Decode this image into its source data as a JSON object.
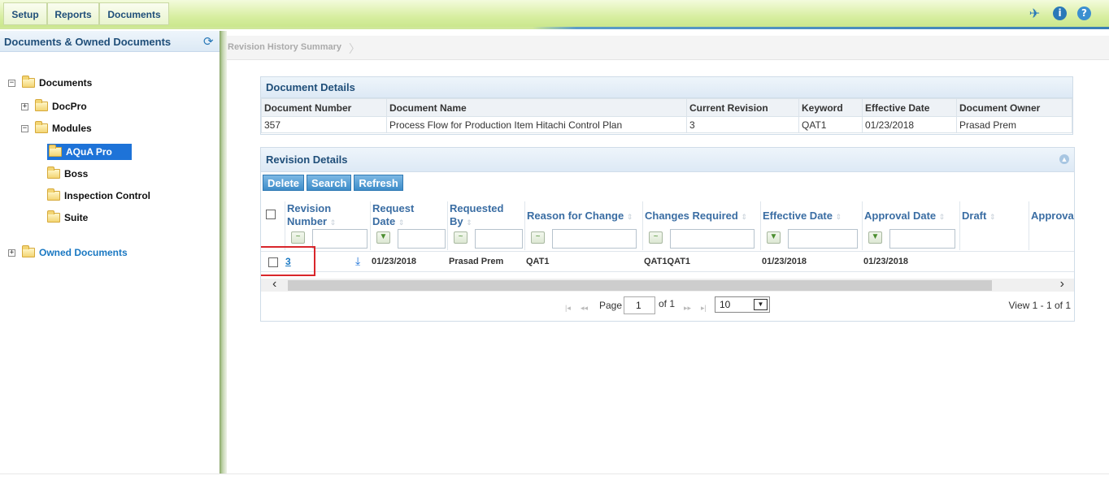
{
  "tabs": [
    {
      "label": "Setup"
    },
    {
      "label": "Reports"
    },
    {
      "label": "Documents"
    }
  ],
  "top_icons": {
    "pin": "pin-icon",
    "info": "i",
    "help": "?"
  },
  "left": {
    "title": "Documents & Owned Documents",
    "tree": {
      "documents": "Documents",
      "docpro": "DocPro",
      "modules": "Modules",
      "aqua_pro": "AQuA Pro",
      "boss": "Boss",
      "inspection_control": "Inspection Control",
      "suite": "Suite",
      "owned_documents": "Owned Documents"
    }
  },
  "breadcrumb": "Revision History Summary",
  "document_details": {
    "title": "Document Details",
    "headers": [
      "Document Number",
      "Document Name",
      "Current Revision",
      "Keyword",
      "Effective Date",
      "Document Owner"
    ],
    "row": [
      "357",
      "Process Flow for Production Item Hitachi Control Plan",
      "3",
      "QAT1",
      "01/23/2018",
      "Prasad Prem"
    ]
  },
  "revision_details": {
    "title": "Revision Details",
    "buttons": {
      "delete": "Delete",
      "search": "Search",
      "refresh": "Refresh"
    },
    "columns": {
      "revision_number_1": "Revision",
      "revision_number_2": "Number",
      "request_date_1": "Request",
      "request_date_2": "Date",
      "requested_by_1": "Requested",
      "requested_by_2": "By",
      "reason": "Reason for Change",
      "changes": "Changes Required",
      "effective": "Effective Date",
      "approval": "Approval Date",
      "draft": "Draft",
      "approval_cut": "Approva"
    },
    "row": {
      "revision": "3",
      "request_date": "01/23/2018",
      "requested_by": "Prasad Prem",
      "reason": "QAT1",
      "changes": "QAT1QAT1",
      "effective": "01/23/2018",
      "approval": "01/23/2018"
    },
    "pager": {
      "page_label": "Page",
      "page_value": "1",
      "of_label": "of 1",
      "rows_value": "10",
      "view": "View 1 - 1 of 1"
    }
  }
}
